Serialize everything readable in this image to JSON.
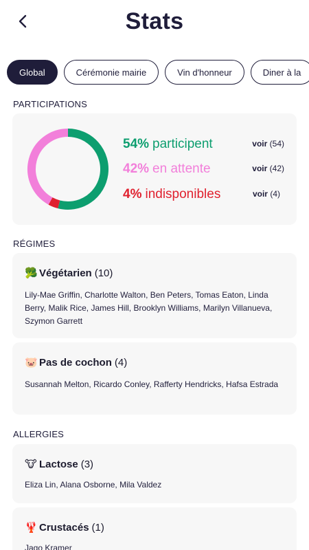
{
  "header": {
    "title": "Stats",
    "back_icon": "chevron-left-icon"
  },
  "tabs": [
    {
      "label": "Global",
      "active": true
    },
    {
      "label": "Cérémonie mairie",
      "active": false
    },
    {
      "label": "Vin d'honneur",
      "active": false
    },
    {
      "label": "Diner à la",
      "active": false
    }
  ],
  "participations": {
    "section_label": "PARTICIPATIONS",
    "colors": {
      "participent": "#0d9e6f",
      "attente": "#f27fda",
      "indispo": "#e0212f"
    },
    "rows": [
      {
        "pct": "54%",
        "label": "participent",
        "voir": "voir",
        "count": "(54)",
        "value": 54
      },
      {
        "pct": "42%",
        "label": "en attente",
        "voir": "voir",
        "count": "(42)",
        "value": 42
      },
      {
        "pct": "4%",
        "label": "indisponibles",
        "voir": "voir",
        "count": "(4)",
        "value": 4
      }
    ]
  },
  "regimes": {
    "section_label": "RÉGIMES",
    "items": [
      {
        "emoji": "🥦",
        "title": "Végétarien",
        "count": "(10)",
        "names": "Lily-Mae Griffin, Charlotte Walton, Ben Peters, Tomas Eaton, Linda Berry, Malik Rice, James Hill, Brooklyn Williams, Marilyn Villanueva, Szymon Garrett"
      },
      {
        "emoji": "🐷",
        "title": "Pas de cochon",
        "count": "(4)",
        "names": "Susannah Melton, Ricardo Conley, Rafferty Hendricks, Hafsa Estrada"
      }
    ]
  },
  "allergies": {
    "section_label": "ALLERGIES",
    "items": [
      {
        "emoji": "🐮",
        "title": "Lactose",
        "count": "(3)",
        "names": "Eliza Lin, Alana Osborne, Mila Valdez"
      },
      {
        "emoji": "🦞",
        "title": "Crustacés",
        "count": "(1)",
        "names": "Jago Kramer"
      }
    ]
  }
}
